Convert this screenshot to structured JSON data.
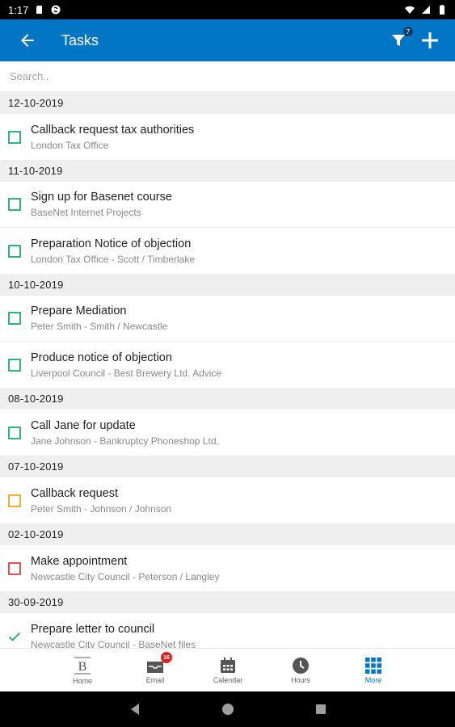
{
  "status_bar": {
    "time": "1:17"
  },
  "app_bar": {
    "title": "Tasks",
    "filter_count": "7"
  },
  "search": {
    "placeholder": "Search.."
  },
  "groups": [
    {
      "date": "12-10-2019",
      "tasks": [
        {
          "title": "Callback request tax authorities",
          "subtitle": "London Tax Office",
          "status": "green"
        }
      ]
    },
    {
      "date": "11-10-2019",
      "tasks": [
        {
          "title": "Sign up for Basenet course",
          "subtitle": "BaseNet Internet Projects",
          "status": "green"
        },
        {
          "title": "Preparation Notice of objection",
          "subtitle": "London Tax Office - Scott / Timberlake",
          "status": "green"
        }
      ]
    },
    {
      "date": "10-10-2019",
      "tasks": [
        {
          "title": "Prepare Mediation",
          "subtitle": "Peter Smith - Smith / Newcastle",
          "status": "green"
        },
        {
          "title": "Produce notice of objection",
          "subtitle": "Liverpool Council - Best Brewery Ltd. Advice",
          "status": "green"
        }
      ]
    },
    {
      "date": "08-10-2019",
      "tasks": [
        {
          "title": "Call Jane for update",
          "subtitle": "Jane Johnson - Bankruptcy Phoneshop Ltd.",
          "status": "green"
        }
      ]
    },
    {
      "date": "07-10-2019",
      "tasks": [
        {
          "title": "Callback request",
          "subtitle": "Peter Smith - Johnson / Johnson",
          "status": "orange"
        }
      ]
    },
    {
      "date": "02-10-2019",
      "tasks": [
        {
          "title": "Make appointment",
          "subtitle": "Newcastle City Council - Peterson / Langley",
          "status": "red"
        }
      ]
    },
    {
      "date": "30-09-2019",
      "tasks": [
        {
          "title": "Prepare letter to council",
          "subtitle": "Newcastle City Council - BaseNet files",
          "status": "done"
        }
      ]
    }
  ],
  "bottom_nav": [
    {
      "label": "Home",
      "icon": "basenet-logo-icon"
    },
    {
      "label": "Email",
      "icon": "inbox-icon",
      "badge": "16"
    },
    {
      "label": "Calendar",
      "icon": "calendar-icon"
    },
    {
      "label": "Hours",
      "icon": "clock-icon"
    },
    {
      "label": "More",
      "icon": "grid-icon",
      "active": true
    }
  ],
  "colors": {
    "primary": "#0275c4",
    "green": "#34b07a",
    "orange": "#f1ad3a",
    "red": "#e05050"
  }
}
